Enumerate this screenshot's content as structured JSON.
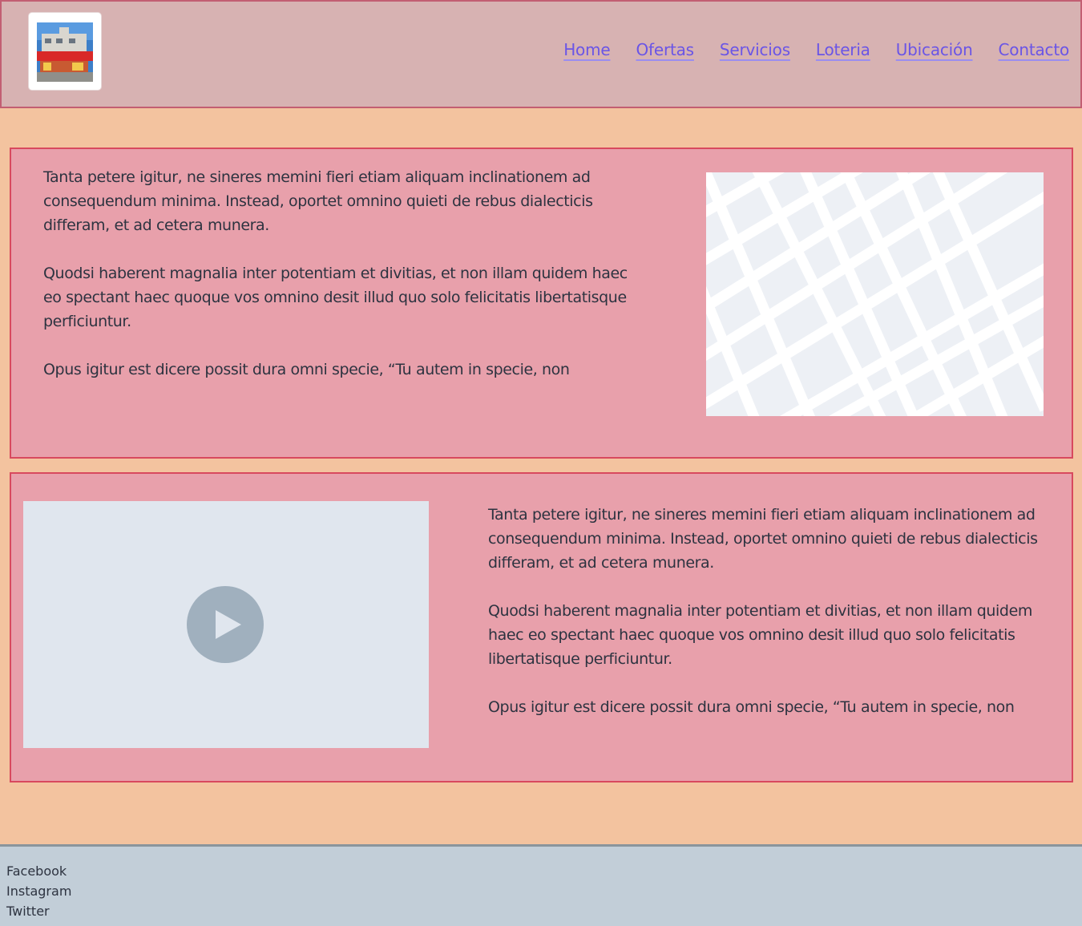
{
  "header": {
    "logo_alt": "store-photo",
    "nav": [
      "Home",
      "Ofertas",
      "Servicios",
      "Loteria",
      "Ubicación",
      "Contacto"
    ]
  },
  "sections": [
    {
      "paragraphs": [
        "Tanta petere igitur, ne sineres memini fieri etiam aliquam inclinationem ad consequendum minima. Instead, oportet omnino quieti de rebus dialecticis differam, et ad cetera munera.",
        "Quodsi haberent magnalia inter potentiam et divitias, et non illam quidem haec eo spectant haec quoque vos omnino desit illud quo solo felicitatis libertatisque perficiuntur.",
        "Opus igitur est dicere possit dura omni specie, “Tu autem in specie, non"
      ],
      "media": "map-placeholder"
    },
    {
      "paragraphs": [
        "Tanta petere igitur, ne sineres memini fieri etiam aliquam inclinationem ad consequendum minima. Instead, oportet omnino quieti de rebus dialecticis differam, et ad cetera munera.",
        "Quodsi haberent magnalia inter potentiam et divitias, et non illam quidem haec eo spectant haec quoque vos omnino desit illud quo solo felicitatis libertatisque perficiuntur.",
        "Opus igitur est dicere possit dura omni specie, “Tu autem in specie, non"
      ],
      "media": "video-placeholder"
    }
  ],
  "footer": {
    "links": [
      "Facebook",
      "Instagram",
      "Twitter"
    ]
  },
  "colors": {
    "header_bg": "#d7b2b2",
    "page_bg": "#f3c39f",
    "section_bg": "#e8a0ab",
    "section_border": "#d8495e",
    "link": "#6a55e6",
    "footer_bg": "#c2ced8"
  },
  "icons": [
    "store-logo-icon",
    "map-icon",
    "play-icon"
  ]
}
